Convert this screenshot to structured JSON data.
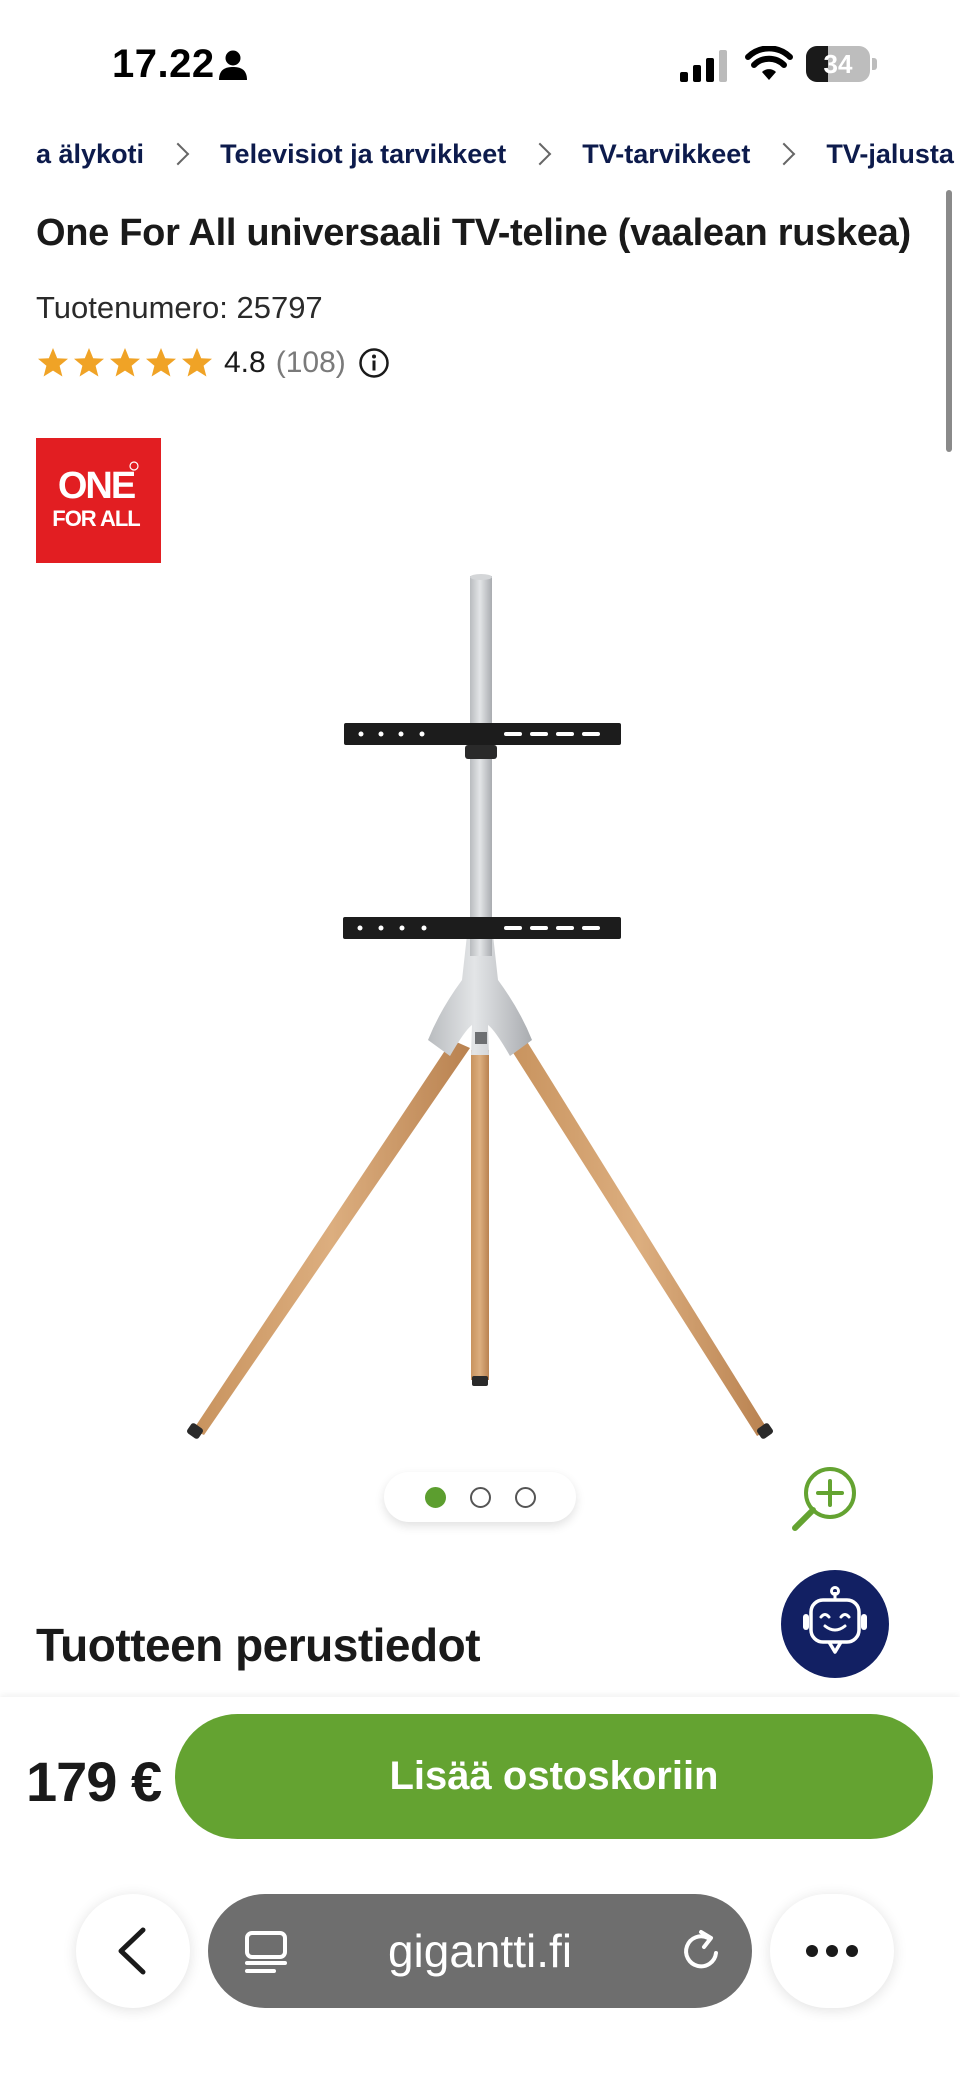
{
  "status_bar": {
    "time": "17.22",
    "battery_level": "34",
    "battery_fraction": 0.34,
    "icons": [
      "person-icon",
      "signal-icon",
      "wifi-icon",
      "battery-icon"
    ]
  },
  "breadcrumb": {
    "items": [
      "a älykoti",
      "Televisiot ja tarvikkeet",
      "TV-tarvikkeet",
      "TV-jalusta"
    ]
  },
  "product": {
    "title": "One For All universaali TV-teline (vaalean ruskea)",
    "sku_label": "Tuotenumero:",
    "sku_value": "25797",
    "rating": "4.8",
    "rating_count": "(108)",
    "stars": 5,
    "brand_logo": {
      "line1": "ONE",
      "line2": "FOR ALL",
      "color": "#e21e22"
    }
  },
  "gallery": {
    "image_count": 3,
    "active_index": 0
  },
  "section": {
    "heading": "Tuotteen perustiedot"
  },
  "purchase": {
    "price": "179 €",
    "add_to_cart_label": "Lisää ostoskoriin",
    "button_color": "#64a331"
  },
  "browser": {
    "url": "gigantti.fi",
    "icons": [
      "back-icon",
      "tabs-icon",
      "reload-icon",
      "more-icon"
    ]
  },
  "colors": {
    "accent_green": "#64a331",
    "navy": "#122063",
    "star": "#f0a326"
  }
}
